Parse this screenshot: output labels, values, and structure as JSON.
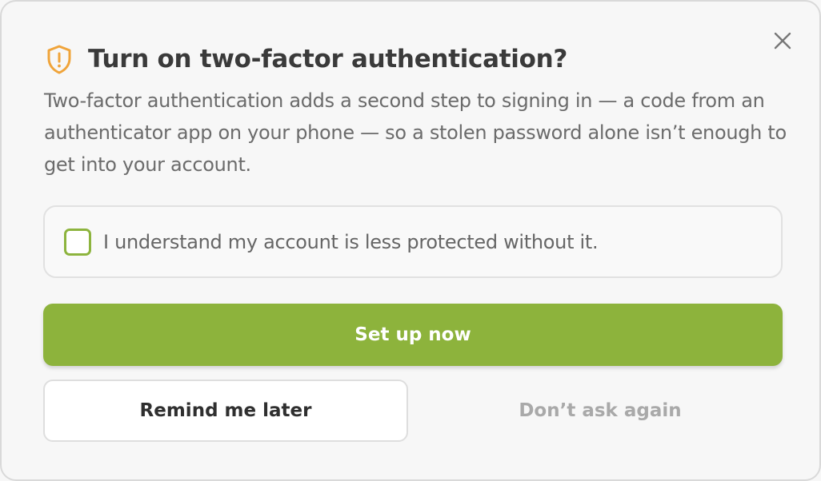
{
  "dialog": {
    "title": "Turn on two-factor authentication?",
    "title_icon": "shield-alert-icon",
    "close_icon": "close-icon",
    "description": "Two-factor authentication adds a second step to signing in — a code from an authenticator app on your phone — so a stolen password alone isn’t enough to get into your account.",
    "acknowledgement": {
      "label": "I understand my account is less protected without it.",
      "checked": false
    },
    "buttons": {
      "primary": "Set up now",
      "secondary": "Remind me later",
      "tertiary": "Don’t ask again"
    }
  },
  "colors": {
    "accent": "#8db33c",
    "warning_icon": "#f0a43a",
    "title": "#3a3a3a",
    "body_text": "#6b6b6b",
    "disabled_text": "#a9a9a9"
  }
}
